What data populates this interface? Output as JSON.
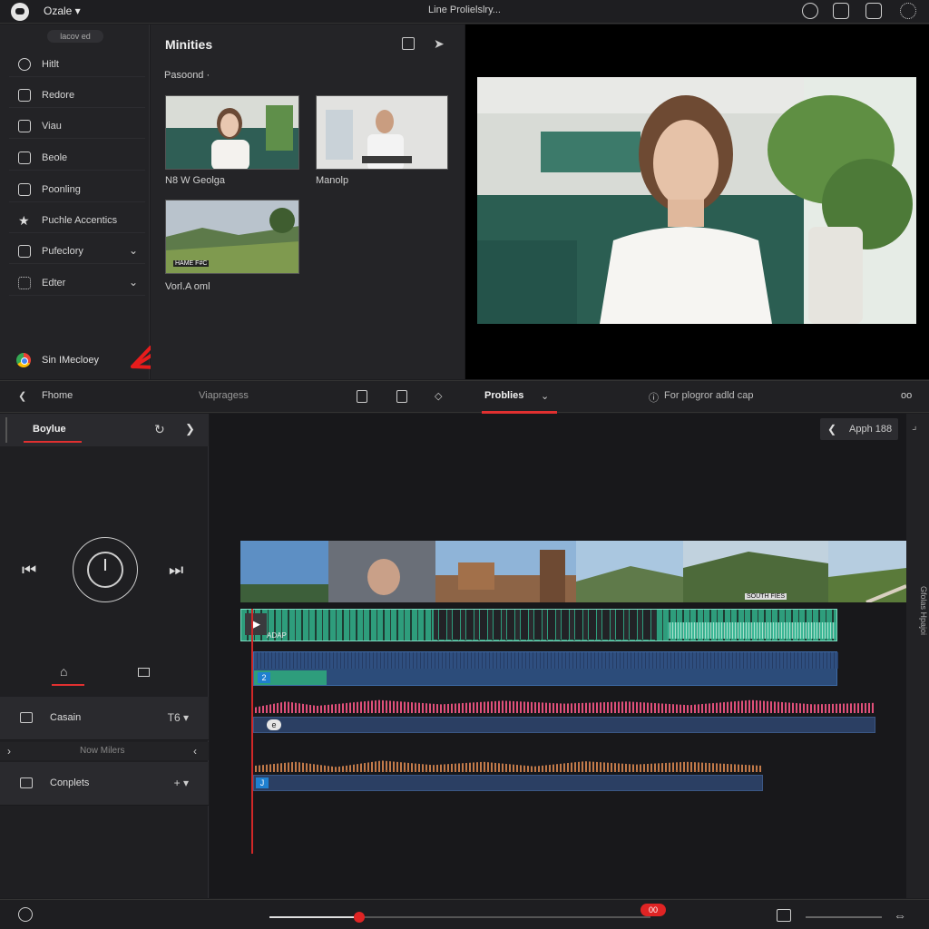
{
  "topbar": {
    "app_name": "Ozale ▾",
    "window_title": "Line Prolielslry..."
  },
  "sidebar": {
    "pill": "lacov ed",
    "items": [
      {
        "label": "Hitlt",
        "icon": "clock-icon"
      },
      {
        "label": "Redore",
        "icon": "folder-icon"
      },
      {
        "label": "Viau",
        "icon": "monitor-icon"
      },
      {
        "label": "Beole",
        "icon": "camera-icon"
      },
      {
        "label": "Poonling",
        "icon": "film-icon"
      },
      {
        "label": "Puchle Accentics",
        "icon": "star-icon"
      },
      {
        "label": "Pufeclory",
        "icon": "layout-icon",
        "chevron": "⌄"
      },
      {
        "label": "Edter",
        "icon": "grid-icon",
        "chevron": "⌄"
      }
    ],
    "footer_label": "Sin IMecloey"
  },
  "media": {
    "title": "Minities",
    "filter": "Pasoond  ·",
    "items": [
      {
        "label": "N8 W Geolga"
      },
      {
        "label": "Manolp"
      },
      {
        "label": "Vorl.A oml",
        "overlay": "HAME F#C"
      }
    ]
  },
  "toolbar": {
    "home": "Fhome",
    "viapragess": "Viapragess",
    "active_tab": "Problies",
    "caption": "For plogror adld cap",
    "more": "oo"
  },
  "control": {
    "tab_label": "Boylue",
    "rows": [
      {
        "label": "Casain",
        "right": "T6 ▾"
      },
      {
        "label": "Now Milers"
      },
      {
        "label": "Conplets",
        "right": "+ ▾"
      }
    ]
  },
  "timeline": {
    "back_label": "Apph 188",
    "clip_label": "ADAP",
    "track_numbers": [
      "2",
      "e",
      "J"
    ],
    "film_overlay": "SOUTH FIES",
    "side_label": "Gfolas Hpajoi"
  },
  "bottombar": {
    "time_badge": "00"
  },
  "colors": {
    "accent": "#e03030",
    "video_track": "#2e9d7c",
    "audio_pink": "#e0507a",
    "audio_orange": "#c27a4a",
    "audio_bar": "#3a5a8c"
  }
}
